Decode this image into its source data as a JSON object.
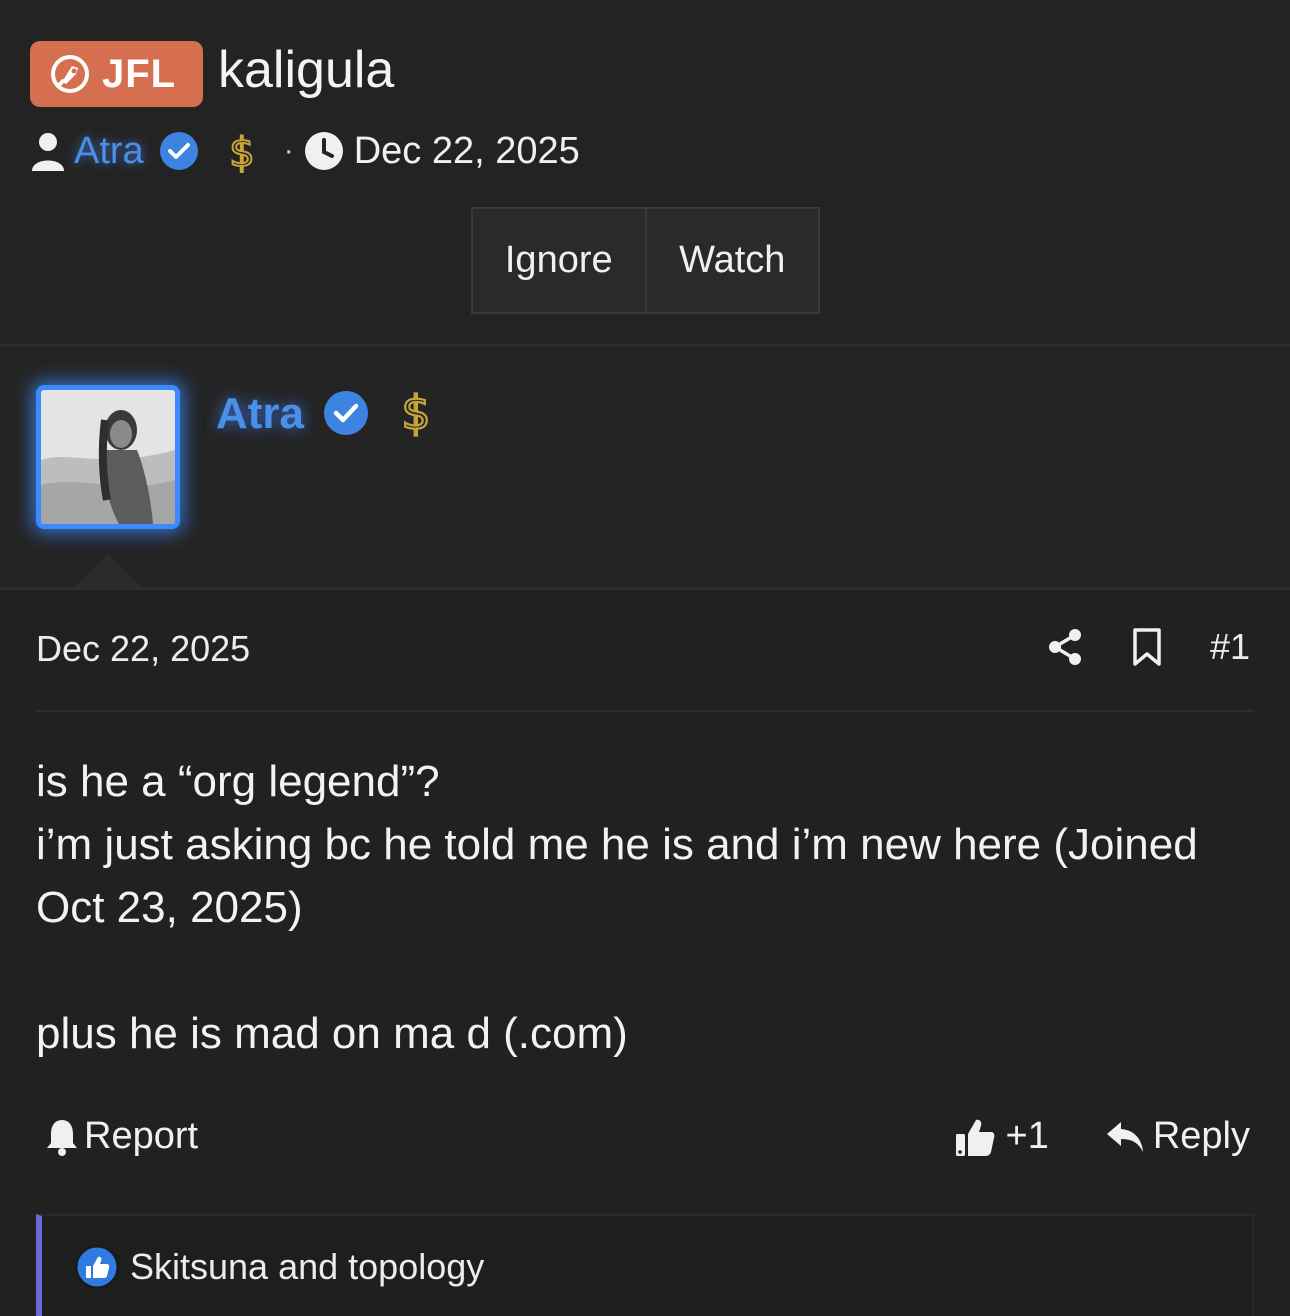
{
  "thread": {
    "prefix": "JFL",
    "title": "kaligula",
    "author": "Atra",
    "date": "Dec 22, 2025",
    "separator": "·"
  },
  "buttons": {
    "ignore": "Ignore",
    "watch": "Watch"
  },
  "poster": {
    "name": "Atra"
  },
  "post": {
    "date": "Dec 22, 2025",
    "number": "#1",
    "body": [
      "is he a “org legend”?",
      "i’m just asking bc he told me he is and i’m new here (Joined Oct 23, 2025)",
      "plus he is mad on ma d (.com)"
    ],
    "report_label": "Report",
    "like_count": "+1",
    "reply_label": "Reply",
    "reactions_text": "Skitsuna and topology"
  },
  "colors": {
    "background": "#232323",
    "prefix_badge": "#d66e50",
    "username_blue": "#4a8fe8",
    "avatar_border": "#3b8bff",
    "reaction_bar": "#6a6bd6",
    "dollar_gold": "#c9a43a"
  },
  "icons": [
    "rocket-icon",
    "user-icon",
    "verified-icon",
    "dollar-icon",
    "clock-icon",
    "share-icon",
    "bookmark-icon",
    "bell-icon",
    "thumbs-up-icon",
    "reply-icon",
    "like-reaction-icon"
  ]
}
